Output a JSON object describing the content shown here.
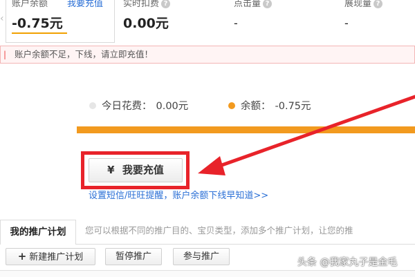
{
  "stats": [
    {
      "label": "账户余额",
      "value": "-0.75元",
      "link": "我要充值"
    },
    {
      "label": "实时扣费",
      "value": "0.00元",
      "help": "?"
    },
    {
      "label": "点击量",
      "value": "-",
      "help": "?"
    },
    {
      "label": "展现量",
      "value": "-",
      "help": "?"
    }
  ],
  "warning": {
    "text": "账户余额不足，下线，请立即充值！"
  },
  "legend": {
    "today_label": "今日花费：",
    "today_value": "0.00元",
    "today_color": "#e6e6e6",
    "balance_label": "余额：",
    "balance_value": "-0.75元",
    "balance_color": "#f29a1f"
  },
  "balance_bar": {
    "fill_fraction": 1.0,
    "color": "#f29a1f"
  },
  "recharge_button": {
    "icon": "yen-icon",
    "symbol": "¥",
    "label": "我要充值"
  },
  "sms_link": {
    "text": "设置短信/旺旺提醒，账户余额下线早知道>>"
  },
  "tabs": {
    "active": "我的推广计划",
    "description": "您可以根据不同的推广目的、宝贝类型，添加多个推广计划，让您的推"
  },
  "toolbar": {
    "new_plan": "新建推广计划",
    "pause": "暂停推广",
    "join": "参与推广"
  },
  "watermark": "头条 @我家丸子是金毛",
  "colors": {
    "accent": "#f29a1f",
    "highlight": "#e8232a",
    "link": "#2a6fd6"
  }
}
